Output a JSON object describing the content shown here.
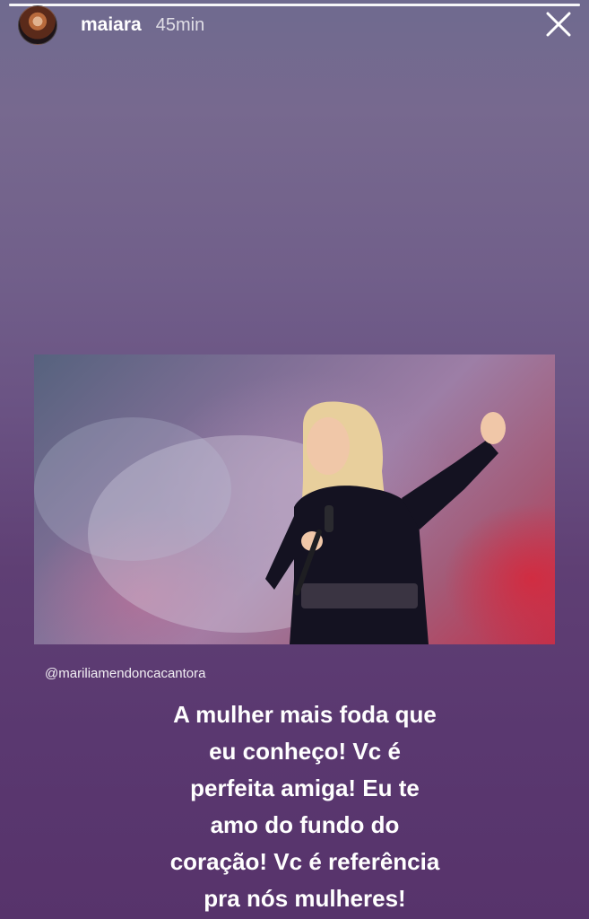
{
  "story": {
    "progress_fraction": 1.0,
    "header": {
      "username": "maiara",
      "time_ago": "45min",
      "close_icon": "close-icon"
    },
    "mention": "@mariliamendoncacantora",
    "caption_lines": [
      "A mulher mais foda que",
      "eu conheço! Vc é",
      "perfeita amiga! Eu te",
      "amo do fundo do",
      "coração! Vc é referência",
      "pra nós mulheres!"
    ]
  },
  "colors": {
    "background_top": "#6f6a8f",
    "background_bottom": "#57336b",
    "text": "#ffffff"
  }
}
